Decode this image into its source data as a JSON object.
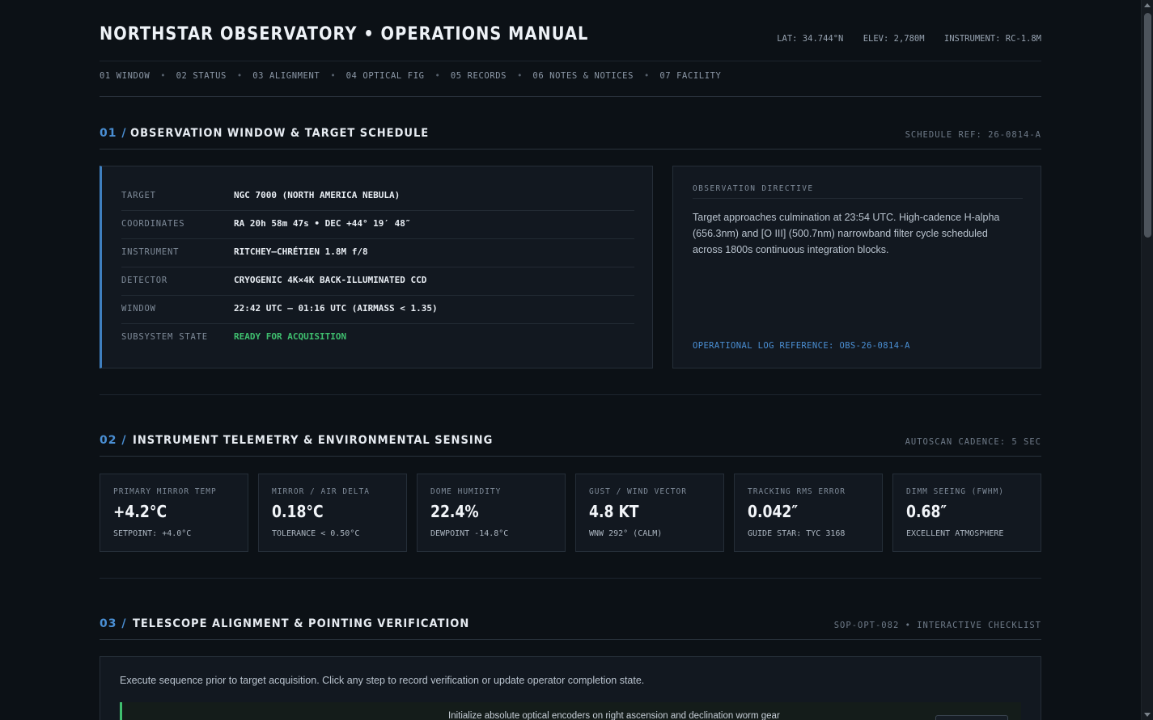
{
  "header": {
    "title": "NORTHSTAR OBSERVATORY • OPERATIONS MANUAL",
    "meta": [
      "LAT: 34.744°N",
      "ELEV: 2,780M",
      "INSTRUMENT: RC-1.8M"
    ]
  },
  "nav": {
    "items": [
      "01 WINDOW",
      "02 STATUS",
      "03 ALIGNMENT",
      "04 OPTICAL FIG",
      "05 RECORDS",
      "06 NOTES & NOTICES",
      "07 FACILITY"
    ],
    "separator": "•"
  },
  "section1": {
    "num": "01 /",
    "title": "OBSERVATION WINDOW & TARGET SCHEDULE",
    "ref": "SCHEDULE REF: 26-0814-A",
    "rows": [
      {
        "label": "TARGET",
        "value": "NGC 7000 (NORTH AMERICA NEBULA)"
      },
      {
        "label": "COORDINATES",
        "value": "RA 20h 58m 47s • DEC +44° 19′ 48″"
      },
      {
        "label": "INSTRUMENT",
        "value": "RITCHEY–CHRÉTIEN 1.8M f/8"
      },
      {
        "label": "DETECTOR",
        "value": "CRYOGENIC 4K×4K BACK-ILLUMINATED CCD"
      },
      {
        "label": "WINDOW",
        "value": "22:42 UTC – 01:16 UTC (AIRMASS < 1.35)"
      },
      {
        "label": "SUBSYSTEM STATE",
        "value": "READY FOR ACQUISITION"
      }
    ],
    "directive": {
      "label": "OBSERVATION DIRECTIVE",
      "text": "Target approaches culmination at 23:54 UTC. High-cadence H-alpha (656.3nm) and [O III] (500.7nm) narrowband filter cycle scheduled across 1800s continuous integration blocks.",
      "ref": "OPERATIONAL LOG REFERENCE: OBS-26-0814-A"
    }
  },
  "section2": {
    "num": "02 /",
    "title": "INSTRUMENT TELEMETRY & ENVIRONMENTAL SENSING",
    "ref": "AUTOSCAN CADENCE: 5 SEC",
    "cards": [
      {
        "label": "PRIMARY MIRROR TEMP",
        "value": "+4.2°C",
        "sub": "SETPOINT: +4.0°C"
      },
      {
        "label": "MIRROR / AIR DELTA",
        "value": "0.18°C",
        "sub": "TOLERANCE < 0.50°C"
      },
      {
        "label": "DOME HUMIDITY",
        "value": "22.4%",
        "sub": "DEWPOINT -14.8°C"
      },
      {
        "label": "GUST / WIND VECTOR",
        "value": "4.8 KT",
        "sub": "WNW 292° (CALM)"
      },
      {
        "label": "TRACKING RMS ERROR",
        "value": "0.042″",
        "sub": "GUIDE STAR: TYC 3168"
      },
      {
        "label": "DIMM SEEING (FWHM)",
        "value": "0.68″",
        "sub": "EXCELLENT ATMOSPHERE"
      }
    ]
  },
  "section3": {
    "num": "03 /",
    "title": "TELESCOPE ALIGNMENT & POINTING VERIFICATION",
    "ref": "SOP-OPT-082 • INTERACTIVE CHECKLIST",
    "intro": "Execute sequence prior to target acquisition. Click any step to record verification or update operator completion state.",
    "step1": "Initialize absolute optical encoders on right ascension and declination worm gear"
  },
  "colors": {
    "accent": "#4a8fd4",
    "ready": "#3fbf6f",
    "background": "#0c1116",
    "panel": "#121820"
  }
}
